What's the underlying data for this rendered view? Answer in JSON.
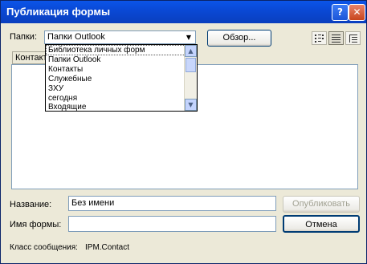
{
  "window": {
    "title": "Публикация формы"
  },
  "titlebar": {
    "help_glyph": "?",
    "close_glyph": "✕"
  },
  "folders": {
    "label": "Папки:",
    "selected": "Папки Outlook",
    "arrow_glyph": "▼",
    "browse_label": "Обзор...",
    "dropdown_items": [
      "Библиотека личных форм",
      "Папки Outlook",
      "Контакты",
      "Служебные",
      "ЗХУ",
      "сегодня",
      "Входящие"
    ],
    "scroll_up_glyph": "▲",
    "scroll_down_glyph": "▼"
  },
  "view_buttons": [
    "large-icons-view",
    "small-icons-view",
    "list-view"
  ],
  "list": {
    "column_header": "Контакт"
  },
  "name_field": {
    "label": "Название:",
    "value": "Без имени"
  },
  "form_name_field": {
    "label": "Имя формы:",
    "value": ""
  },
  "buttons": {
    "publish": "Опубликовать",
    "cancel": "Отмена"
  },
  "message_class": {
    "label": "Класс сообщения:",
    "value": "IPM.Contact"
  },
  "colors": {
    "titlebar": "#0a49d6",
    "dialog_bg": "#ece9d8",
    "field_border": "#7f9db9",
    "close_button": "#c8451d"
  }
}
